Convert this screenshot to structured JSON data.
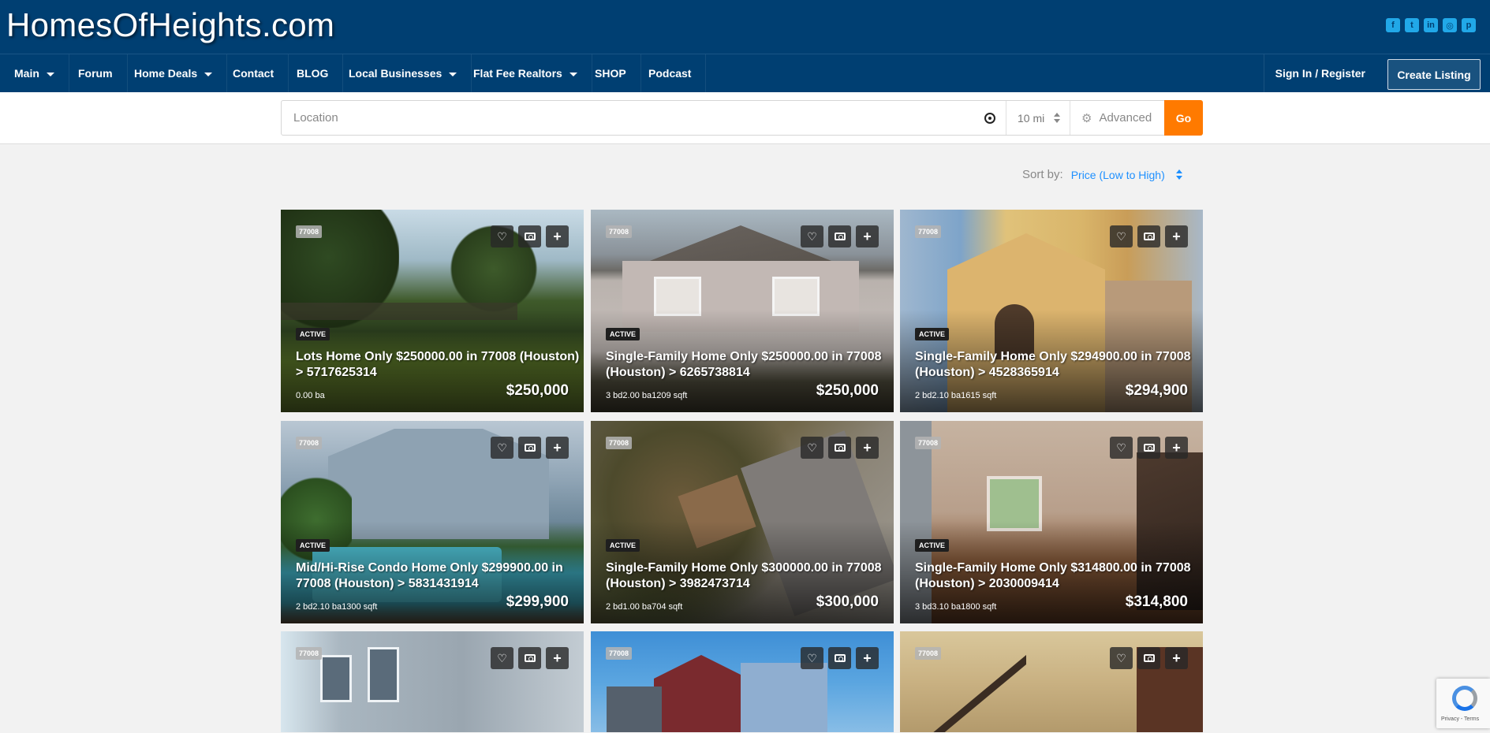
{
  "site": {
    "title": "HomesOfHeights.com",
    "social": [
      "facebook-icon",
      "twitter-icon",
      "linkedin-icon",
      "instagram-icon",
      "pinterest-icon"
    ],
    "social_glyphs": [
      "f",
      "t",
      "in",
      "◎",
      "p"
    ]
  },
  "nav": {
    "items": [
      {
        "label": "Main",
        "dropdown": true
      },
      {
        "label": "Forum",
        "dropdown": false
      },
      {
        "label": "Home Deals",
        "dropdown": true
      },
      {
        "label": "Contact",
        "dropdown": false
      },
      {
        "label": "BLOG",
        "dropdown": false
      },
      {
        "label": "Local Businesses",
        "dropdown": true
      },
      {
        "label": "Flat Fee Realtors",
        "dropdown": true
      },
      {
        "label": "SHOP",
        "dropdown": false
      },
      {
        "label": "Podcast",
        "dropdown": false
      }
    ],
    "signin": "Sign In / Register",
    "create": "Create Listing"
  },
  "search": {
    "placeholder": "Location",
    "value": "",
    "radius": "10 mi",
    "advanced": "Advanced",
    "go": "Go"
  },
  "sort": {
    "label": "Sort by:",
    "value": "Price (Low to High)"
  },
  "colors": {
    "header": "#003f72",
    "accent": "#ff7a00",
    "link": "#1e90ff"
  },
  "listings": [
    {
      "zip": "77008",
      "status": "ACTIVE",
      "title": "Lots Home Only $250000.00 in 77008 (Houston) > 5717625314",
      "specs": "0.00 ba",
      "price": "$250,000"
    },
    {
      "zip": "77008",
      "status": "ACTIVE",
      "title": "Single-Family Home Only $250000.00 in 77008 (Houston) > 6265738814",
      "specs": "3 bd2.00 ba1209 sqft",
      "price": "$250,000"
    },
    {
      "zip": "77008",
      "status": "ACTIVE",
      "title": "Single-Family Home Only $294900.00 in 77008 (Houston) > 4528365914",
      "specs": "2 bd2.10 ba1615 sqft",
      "price": "$294,900"
    },
    {
      "zip": "77008",
      "status": "ACTIVE",
      "title": "Mid/Hi-Rise Condo Home Only $299900.00 in 77008 (Houston) > 5831431914",
      "specs": "2 bd2.10 ba1300 sqft",
      "price": "$299,900"
    },
    {
      "zip": "77008",
      "status": "ACTIVE",
      "title": "Single-Family Home Only $300000.00 in 77008 (Houston) > 3982473714",
      "specs": "2 bd1.00 ba704 sqft",
      "price": "$300,000"
    },
    {
      "zip": "77008",
      "status": "ACTIVE",
      "title": "Single-Family Home Only $314800.00 in 77008 (Houston) > 2030009414",
      "specs": "3 bd3.10 ba1800 sqft",
      "price": "$314,800"
    },
    {
      "zip": "77008"
    },
    {
      "zip": "77008"
    },
    {
      "zip": "77008"
    }
  ],
  "recaptcha": {
    "text": "Privacy - Terms"
  }
}
